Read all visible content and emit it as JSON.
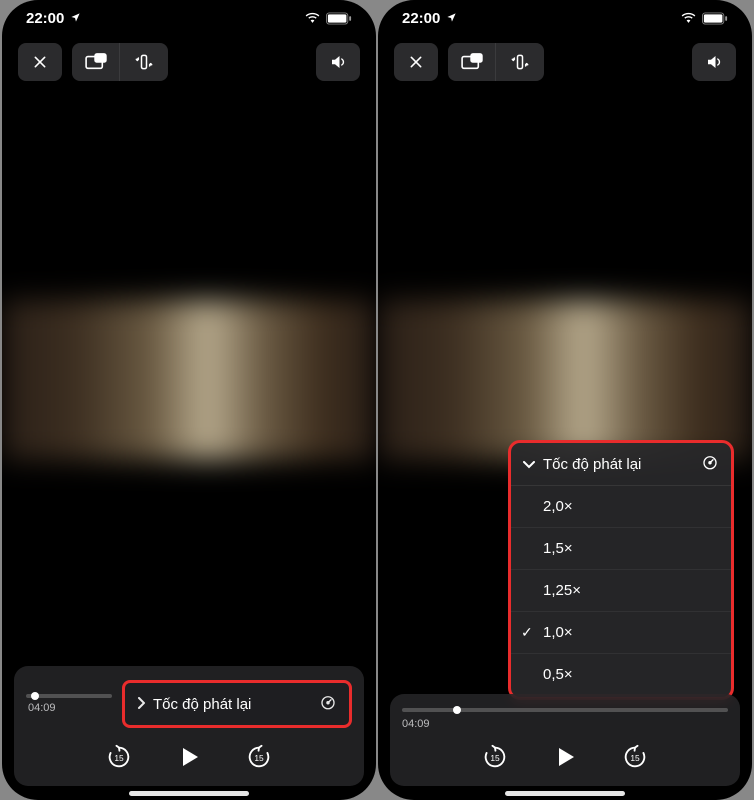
{
  "status": {
    "time": "22:00"
  },
  "player": {
    "timecode": "04:09",
    "speed_label": "Tốc độ phát lại"
  },
  "speed_menu": {
    "header": "Tốc độ phát lại",
    "options": [
      "2,0×",
      "1,5×",
      "1,25×",
      "1,0×",
      "0,5×"
    ],
    "selected_index": 3
  }
}
